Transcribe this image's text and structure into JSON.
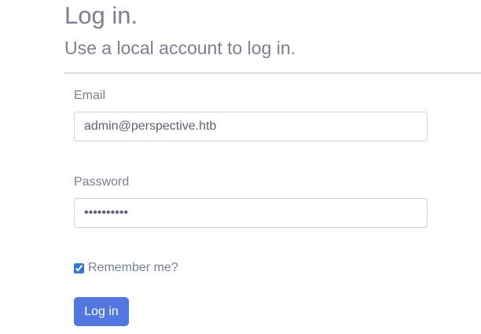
{
  "header": {
    "title": "Log in.",
    "subtitle": "Use a local account to log in."
  },
  "form": {
    "email_label": "Email",
    "email_value": "admin@perspective.htb",
    "password_label": "Password",
    "password_value": "••••••••••",
    "remember_label": "Remember me?",
    "remember_checked": true,
    "submit_label": "Log in"
  },
  "colors": {
    "primary_button": "#5277e0",
    "text": "#7a7f94",
    "divider": "#dcdde3"
  }
}
